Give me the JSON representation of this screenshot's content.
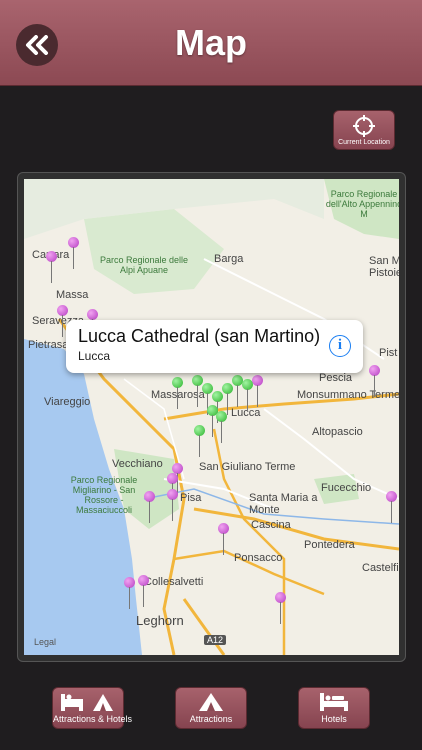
{
  "header": {
    "title": "Map"
  },
  "current_location": {
    "label": "Current Location"
  },
  "map": {
    "places": [
      {
        "name": "Carrara"
      },
      {
        "name": "Massa"
      },
      {
        "name": "Seravezza"
      },
      {
        "name": "Pietrasanta"
      },
      {
        "name": "Barga"
      },
      {
        "name": "San M"
      },
      {
        "name": "Pistoie"
      },
      {
        "name": "Pist"
      },
      {
        "name": "Viareggio"
      },
      {
        "name": "Massarosa"
      },
      {
        "name": "Lucca"
      },
      {
        "name": "Pescia"
      },
      {
        "name": "Monsummano Terme"
      },
      {
        "name": "Altopascio"
      },
      {
        "name": "Vecchiano"
      },
      {
        "name": "San Giuliano Terme"
      },
      {
        "name": "Pisa"
      },
      {
        "name": "Santa Maria a Monte"
      },
      {
        "name": "Fucecchio"
      },
      {
        "name": "Cascina"
      },
      {
        "name": "Pontedera"
      },
      {
        "name": "Ponsacco"
      },
      {
        "name": "Collesalvetti"
      },
      {
        "name": "Castelfi"
      },
      {
        "name": "Leghorn"
      },
      {
        "name": "A12"
      }
    ],
    "parks": [
      {
        "name": "Parco Regionale delle Alpi Apuane"
      },
      {
        "name": "Parco Regionale dell'Alto Appennino M"
      },
      {
        "name": "Parco Regionale Migliarino - San Rossore - Massaciuccoli"
      }
    ],
    "legal": "Legal"
  },
  "callout": {
    "title": "Lucca Cathedral (san Martino)",
    "subtitle": "Lucca"
  },
  "tabs": [
    {
      "label": "Attractions & Hotels",
      "icon": "bed-and-tent-icon"
    },
    {
      "label": "Attractions",
      "icon": "tent-icon"
    },
    {
      "label": "Hotels",
      "icon": "bed-icon"
    }
  ],
  "colors": {
    "header": "#9a5560",
    "pin_purple": "#c04ccc",
    "pin_green": "#3cc63c",
    "info_blue": "#1a7ef2"
  }
}
